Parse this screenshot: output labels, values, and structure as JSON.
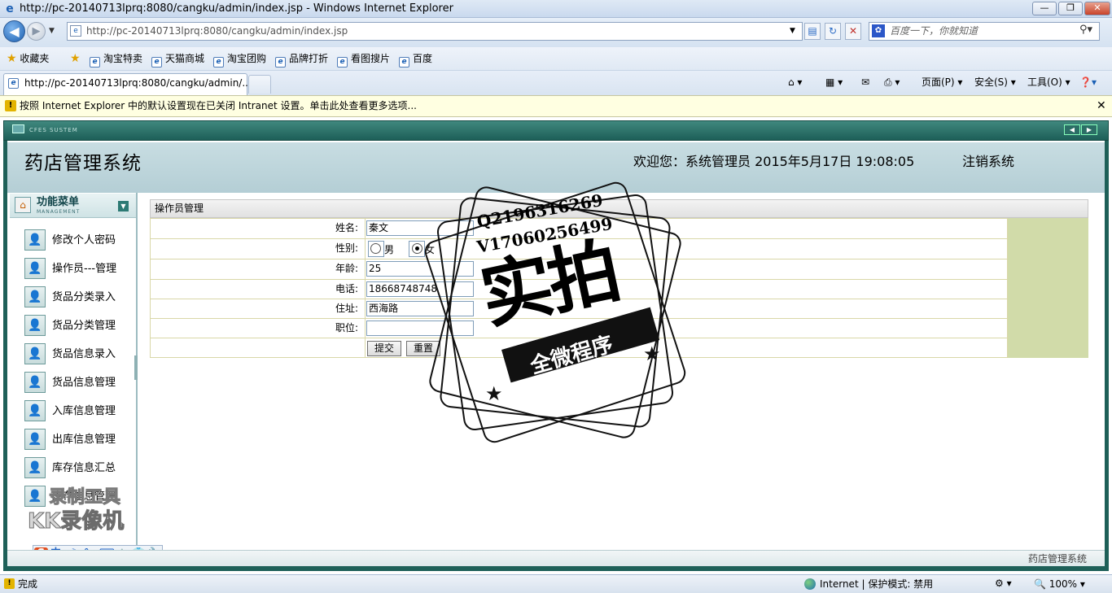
{
  "browser": {
    "window_title": "http://pc-20140713lprq:8080/cangku/admin/index.jsp - Windows Internet Explorer",
    "address": "http://pc-20140713lprq:8080/cangku/admin/index.jsp",
    "search_placeholder": "百度一下，你就知道",
    "favorites_label": "收藏夹",
    "favorites": [
      "淘宝特卖",
      "天猫商城",
      "淘宝团购",
      "品牌打折",
      "看图搜片",
      "百度"
    ],
    "tab_title": "http://pc-20140713lprq:8080/cangku/admin/...",
    "commands": {
      "page": "页面(P)",
      "safety": "安全(S)",
      "tools": "工具(O)"
    },
    "infobar": "按照 Internet Explorer 中的默认设置现在已关闭 Intranet 设置。单击此处查看更多选项...",
    "status": "完成",
    "zone": "Internet | 保护模式: 禁用",
    "zoom": "100%"
  },
  "app": {
    "system_label": "CFES SUSTEM",
    "title": "药店管理系统",
    "welcome": "欢迎您：系统管理员      2015年5月17日  19:08:05",
    "logout": "注销系统",
    "footer": "药店管理系统"
  },
  "menu": {
    "title": "功能菜单",
    "subtitle": "MANAGEMENT",
    "items": [
      {
        "label": "修改个人密码"
      },
      {
        "label": "操作员---管理"
      },
      {
        "label": "货品分类录入"
      },
      {
        "label": "货品分类管理"
      },
      {
        "label": "货品信息录入"
      },
      {
        "label": "货品信息管理"
      },
      {
        "label": "入库信息管理"
      },
      {
        "label": "出库信息管理"
      },
      {
        "label": "库存信息汇总"
      },
      {
        "label": "库存信息管理"
      }
    ]
  },
  "form": {
    "panel_title": "操作员管理",
    "name_label": "姓名:",
    "name_value": "秦文",
    "gender_label": "性别:",
    "gender_male": "男",
    "gender_female": "女",
    "gender_selected": "女",
    "age_label": "年龄:",
    "age_value": "25",
    "phone_label": "电话:",
    "phone_value": "18668748748",
    "address_label": "住址:",
    "address_value": "西海路",
    "position_label": "职位:",
    "position_value": "",
    "submit_label": "提交",
    "reset_label": "重置"
  },
  "ime": {
    "lang": "中"
  },
  "watermark": {
    "qq": "Q2196316269",
    "wechat": "V17060256499",
    "big_text": "实拍",
    "ribbon_text": "全微程序",
    "kk_line1": "录制工具",
    "kk_line2": "KK录像机"
  }
}
